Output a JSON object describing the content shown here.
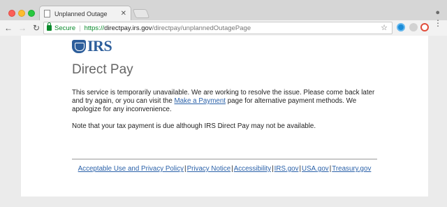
{
  "browser": {
    "tab_title": "Unplanned Outage",
    "tab_close": "✕",
    "secure_label": "Secure",
    "url_scheme": "https://",
    "url_host": "directpay.irs.gov",
    "url_path": "/directpay/unplannedOutagePage"
  },
  "icons": {
    "back": "←",
    "forward": "→",
    "reload": "↻",
    "star": "☆",
    "profile": "●",
    "menu": "⋮"
  },
  "page": {
    "logo_text": "IRS",
    "title": "Direct Pay",
    "message_before": "This service is temporarily unavailable. We are working to resolve the issue. Please come back later and try again, or you can visit the ",
    "message_link": "Make a Payment",
    "message_after": " page for alternative payment methods. We apologize for any inconvenience.",
    "note": "Note that your tax payment is due although IRS Direct Pay may not be available."
  },
  "footer": {
    "links": [
      "Acceptable Use and Privacy Policy",
      "Privacy Notice",
      "Accessibility",
      "IRS.gov",
      "USA.gov",
      "Treasury.gov"
    ],
    "separator": "|"
  },
  "colors": {
    "link": "#2a61a9",
    "brand": "#2d5e9b",
    "secure": "#0a8a2c"
  }
}
